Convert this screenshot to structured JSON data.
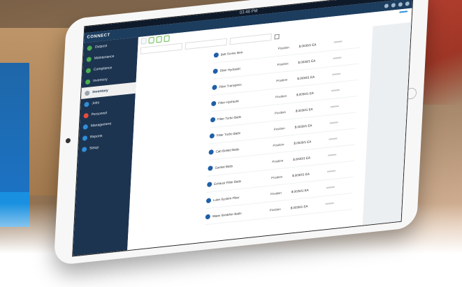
{
  "statusbar": {
    "time": "01:46 PM"
  },
  "app": {
    "brand": "CONNECT"
  },
  "sidebar": {
    "items": [
      {
        "label": "Outpost",
        "color": "#4caf50"
      },
      {
        "label": "Maintenance",
        "color": "#4caf50"
      },
      {
        "label": "Compliance",
        "color": "#4caf50"
      },
      {
        "label": "Inventory",
        "color": "#4caf50"
      },
      {
        "label": "Inventory",
        "color": "#9aa5b1",
        "active": true
      },
      {
        "label": "Jobs",
        "color": "#2f8fd8"
      },
      {
        "label": "Personnel",
        "color": "#e74c3c"
      },
      {
        "label": "Management",
        "color": "#2f8fd8"
      },
      {
        "label": "Reports",
        "color": "#2f8fd8"
      },
      {
        "label": "Setup",
        "color": "#2f8fd8"
      }
    ]
  },
  "rows": [
    {
      "label": "Bolt Screw Item",
      "loc": "Position",
      "price": "$.0030/1 EA"
    },
    {
      "label": "Filter Hydraulic",
      "loc": "Position",
      "price": "$.0030/1 EA"
    },
    {
      "label": "Filter Transpiers",
      "loc": "Position",
      "price": "$.0030/1 EA"
    },
    {
      "label": "Filter Hydraulic",
      "loc": "Position",
      "price": "$.0030/1 EA"
    },
    {
      "label": "Filter Turbo Batts",
      "loc": "Position",
      "price": "$.0030/1 EA"
    },
    {
      "label": "Filter Turbo Batts",
      "loc": "Position",
      "price": "$.0030/1 EA"
    },
    {
      "label": "Cab Bolted Batts",
      "loc": "Position",
      "price": "$.0030/1 EA"
    },
    {
      "label": "Gasket Batts",
      "loc": "Position",
      "price": "$.0030/1 EA"
    },
    {
      "label": "Exhaust Filter Batts",
      "loc": "Position",
      "price": "$.0030/1 EA"
    },
    {
      "label": "Lube System Filter",
      "loc": "Position",
      "price": "$.0030/1 EA"
    },
    {
      "label": "Water Breather Batts",
      "loc": "Position",
      "price": "$.0030/1 EA"
    }
  ],
  "colors": {
    "primary": "#1d3450",
    "accent": "#2f8fd8",
    "green": "#4caf50"
  }
}
